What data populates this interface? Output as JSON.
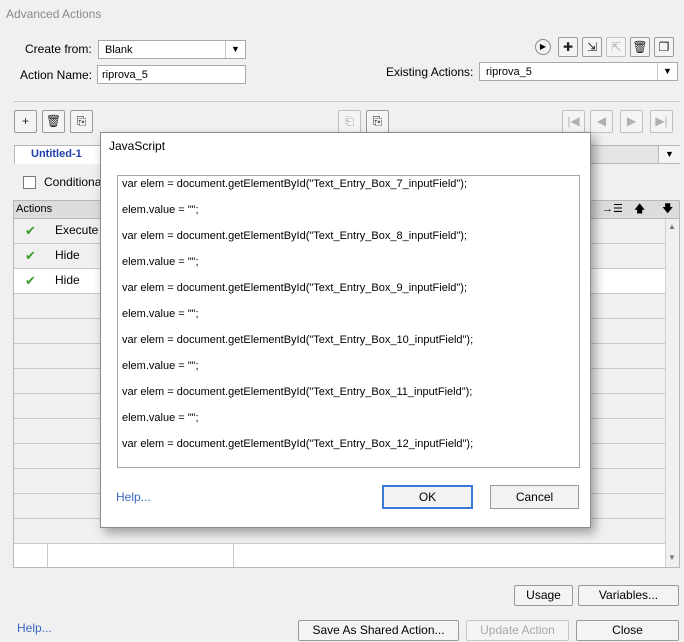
{
  "window": {
    "title": "Advanced Actions"
  },
  "form": {
    "create_from_label": "Create from:",
    "create_from_value": "Blank",
    "action_name_label": "Action Name:",
    "action_name_value": "riprova_5",
    "existing_actions_label": "Existing Actions:",
    "existing_actions_value": "riprova_5"
  },
  "tab": {
    "label": "Untitled-1"
  },
  "conditional": {
    "label": "Conditional"
  },
  "actions_grid": {
    "header": "Actions",
    "rows": [
      {
        "name": "Execute ..."
      },
      {
        "name": "Hide"
      },
      {
        "name": "Hide"
      }
    ]
  },
  "dialog": {
    "title": "JavaScript",
    "code_lines": [
      "var elem = document.getElementById(\"Text_Entry_Box_7_inputField\");",
      "elem.value = \"\";",
      "var elem = document.getElementById(\"Text_Entry_Box_8_inputField\");",
      "elem.value = \"\";",
      "var elem = document.getElementById(\"Text_Entry_Box_9_inputField\");",
      "elem.value = \"\";",
      "var elem = document.getElementById(\"Text_Entry_Box_10_inputField\");",
      "elem.value = \"\";",
      "var elem = document.getElementById(\"Text_Entry_Box_11_inputField\");",
      "elem.value = \"\";",
      "var elem = document.getElementById(\"Text_Entry_Box_12_inputField\");"
    ],
    "help_label": "Help...",
    "ok_label": "OK",
    "cancel_label": "Cancel"
  },
  "bottom": {
    "help_label": "Help...",
    "usage_label": "Usage",
    "variables_label": "Variables...",
    "save_shared_label": "Save As Shared Action...",
    "update_label": "Update Action",
    "close_label": "Close"
  },
  "icons": {
    "check": "✔",
    "dropdown": "▼",
    "checkmark_color": "#3a9a2a",
    "accent": "#3c78d8"
  }
}
